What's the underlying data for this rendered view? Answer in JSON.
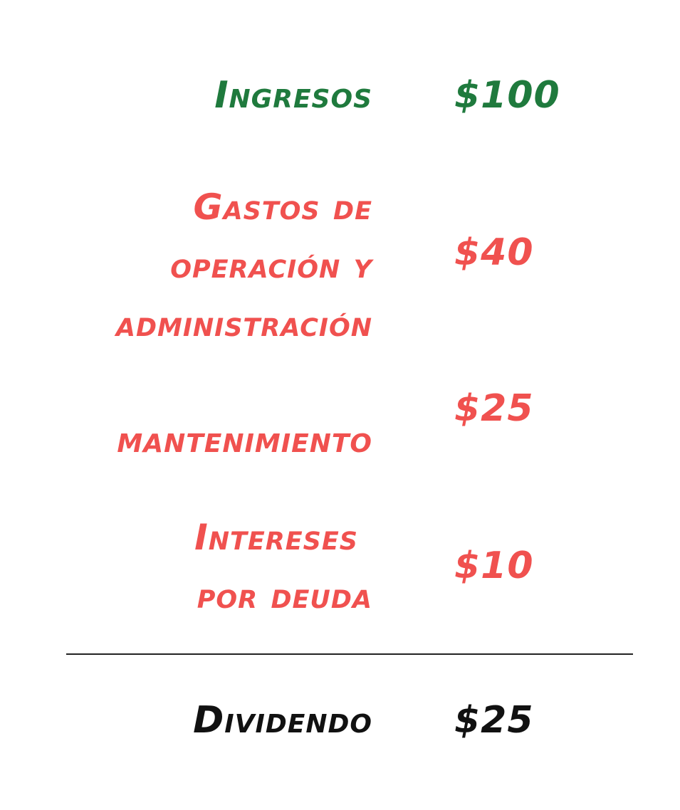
{
  "colors": {
    "income": "#1f7a3d",
    "expense": "#f0514f",
    "total": "#111111",
    "divider": "#222222"
  },
  "rows": [
    {
      "label": "Ingresos",
      "amount": "$100"
    },
    {
      "label_lines": [
        "Gastos de",
        "operación y",
        "administración"
      ],
      "amount": "$40"
    },
    {
      "label": "mantenimiento",
      "amount": "$25"
    },
    {
      "label_lines": [
        "Intereses",
        "por deuda"
      ],
      "amount": "$10"
    }
  ],
  "total": {
    "label": "Dividendo",
    "amount": "$25"
  }
}
